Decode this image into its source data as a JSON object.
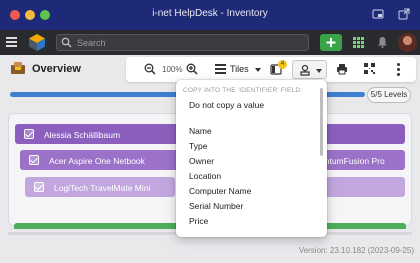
{
  "window": {
    "title": "i-net HelpDesk - Inventory"
  },
  "appbar": {
    "search_placeholder": "Search"
  },
  "header": {
    "title": "Overview",
    "zoom": "100%",
    "view_mode": "Tiles",
    "columns_badge": "4",
    "levels": "5/5 Levels",
    "levels_progress": 1.0
  },
  "cards": [
    {
      "label": "Alessia Schällibaum",
      "color": "#8c5fbf",
      "checked": true
    },
    {
      "label": "Acer Aspire One Netbook",
      "color": "#9b72c8",
      "checked": true
    },
    {
      "label": "LogiTech TravelMate Mini",
      "color": "#c1a7de",
      "checked": true
    }
  ],
  "partial_text": "antumFusion Pro",
  "version": "Version: 23.10.182 (2023-09-25)",
  "dropdown": {
    "header": "COPY INTO THE 'IDENTIFIER' FIELD:",
    "items": [
      "Do not copy a value",
      "Name",
      "Type",
      "Owner",
      "Location",
      "Computer Name",
      "Serial Number",
      "Price"
    ]
  },
  "colors": {
    "titlebar": "#1e2a78",
    "appbar": "#2a2b2f",
    "add_button": "#3aa34a",
    "level_fill": "#3d7fd0",
    "green_strip": "#4cae58"
  }
}
